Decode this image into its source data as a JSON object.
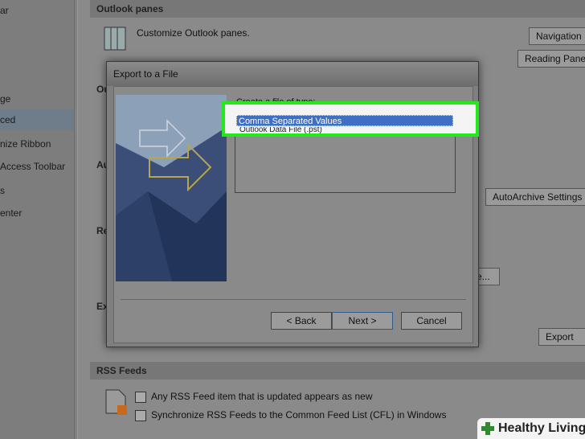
{
  "sidebar": {
    "items": [
      "ar",
      "ge",
      "ced",
      "nize Ribbon",
      "Access Toolbar",
      "s",
      "enter"
    ]
  },
  "sections": {
    "outlook_panes": "Outlook panes",
    "rss_feeds": "RSS Feeds",
    "partial_ou": "Ou",
    "partial_au": "Au",
    "partial_re": "Re",
    "partial_ex": "Ex"
  },
  "outlook_panes": {
    "description": "Customize Outlook panes.",
    "navigation_button": "Navigation",
    "reading_pane_button": "Reading Pane"
  },
  "autoarchive_button": "AutoArchive Settings",
  "partial_browse_button": "e...",
  "export_button": "Export",
  "rss": {
    "option1": "Any RSS Feed item that is updated appears as new",
    "option2": "Synchronize RSS Feeds to the Common Feed List (CFL) in Windows"
  },
  "dialog": {
    "title": "Export to a File",
    "create_label": "Create a file of type:",
    "file_types": [
      "Comma Separated Values",
      "Outlook Data File (.pst)"
    ],
    "selected_index": 0,
    "back_button": "< Back",
    "next_button": "Next >",
    "cancel_button": "Cancel"
  },
  "watermark": {
    "text": "Healthy Living"
  },
  "colors": {
    "highlight": "#23e81c",
    "selection": "#3f6fc4"
  }
}
